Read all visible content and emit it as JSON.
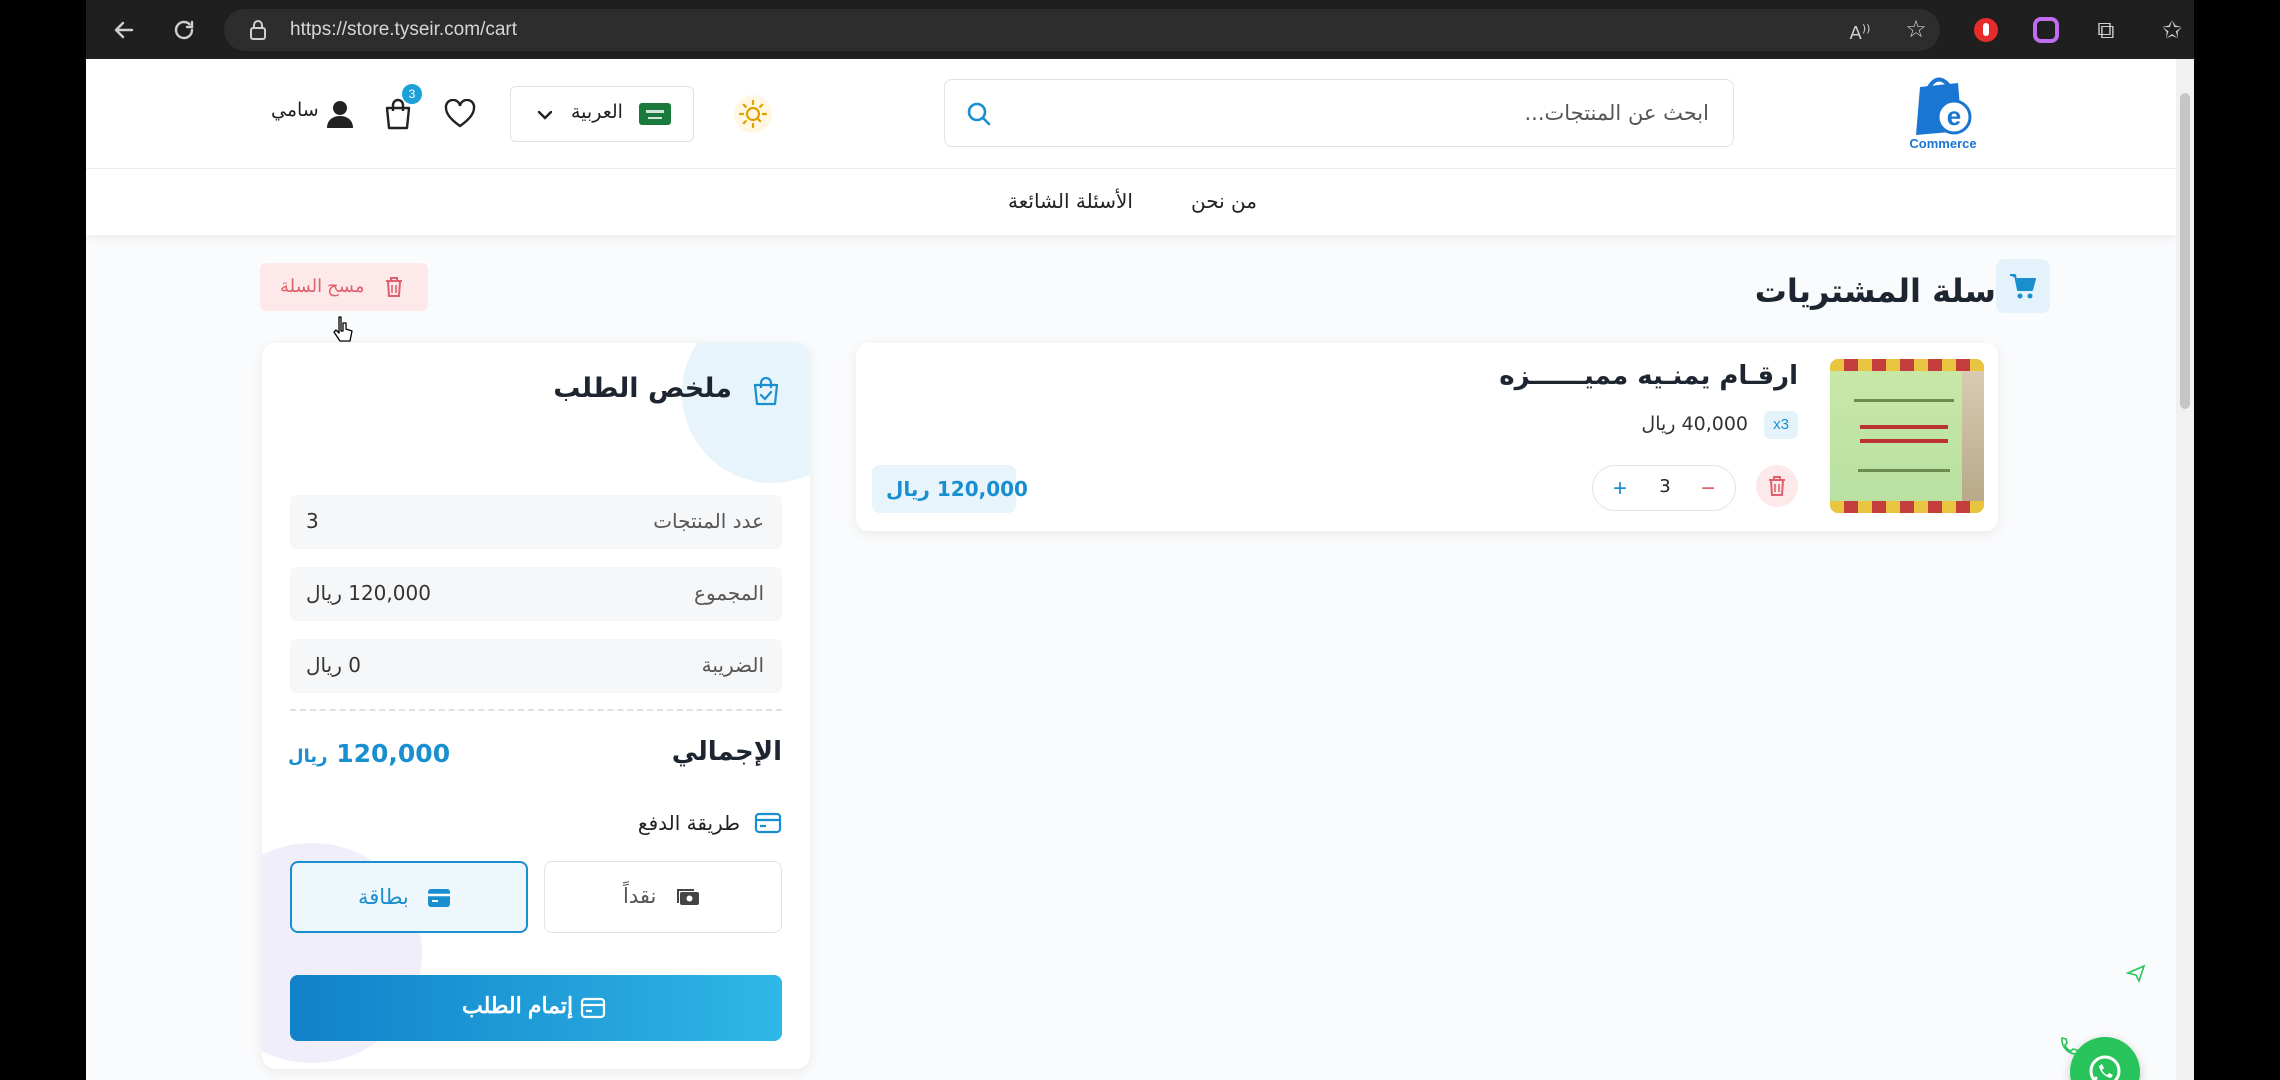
{
  "browser": {
    "url": "https://store.tyseir.com/cart"
  },
  "header": {
    "search_placeholder": "ابحث عن المنتجات...",
    "language": "العربية",
    "cart_count": "3",
    "user_name": "سامي",
    "logo_text": "Commerce",
    "logo_letter": "e"
  },
  "nav": {
    "items": [
      "من نحن",
      "الأسئلة الشائعة"
    ]
  },
  "cart": {
    "title": "سلة المشتريات",
    "clear_label": "مسح السلة"
  },
  "product": {
    "title": "ارقـام يمنـيه مميــــــزه",
    "qty_badge": "x3",
    "unit_price": "40,000 ريال",
    "quantity": "3",
    "line_total": "120,000 ريال"
  },
  "summary": {
    "title": "ملخص الطلب",
    "rows": [
      {
        "label": "عدد المنتجات",
        "value": "3"
      },
      {
        "label": "المجموع",
        "value": "120,000 ريال"
      },
      {
        "label": "الضريبة",
        "value": "0 ريال"
      }
    ],
    "grand_label": "الإجمالي",
    "grand_value": "120,000",
    "grand_currency": "ريال",
    "payment_title": "طريقة الدفع",
    "cash_label": "نقداً",
    "card_label": "بطاقة",
    "checkout_label": "إتمام الطلب"
  },
  "colors": {
    "accent": "#1a8fd0",
    "danger": "#e0606c",
    "whatsapp": "#28c35a"
  }
}
